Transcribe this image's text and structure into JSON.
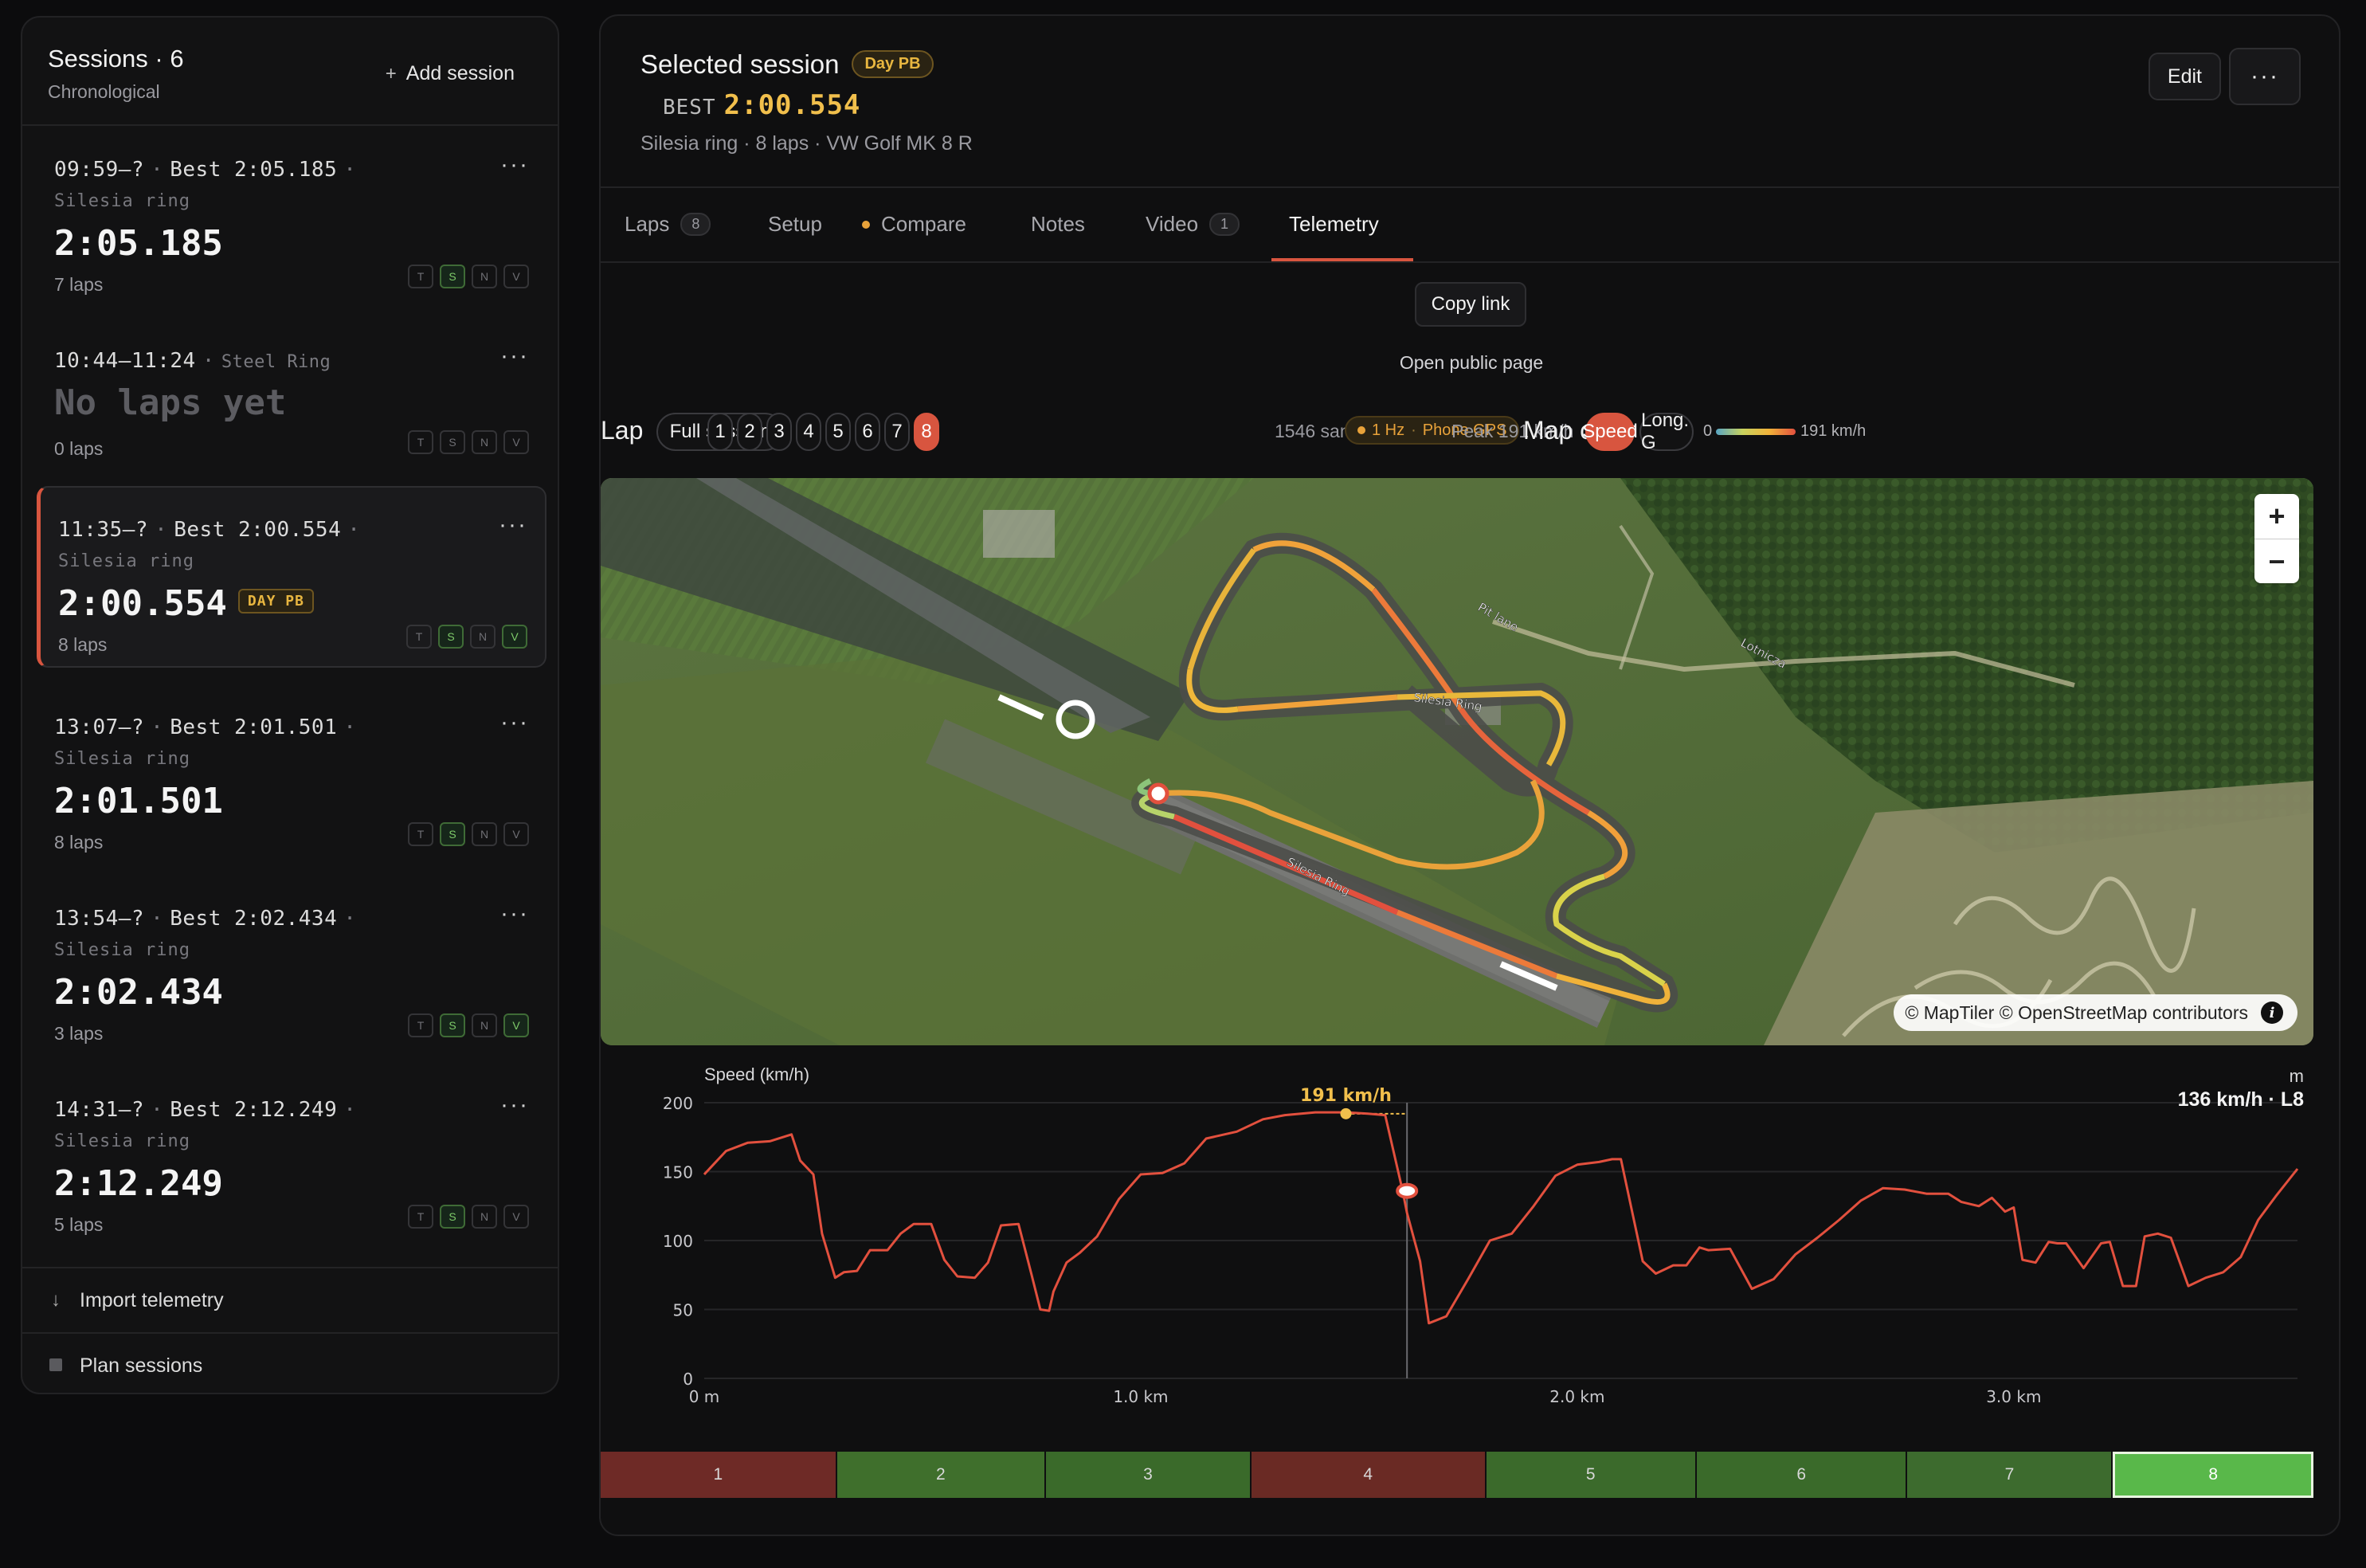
{
  "sidebar": {
    "title": "Sessions · 6",
    "subtitle": "Chronological",
    "add_label": "Add session",
    "sessions": [
      {
        "time_range": "09:59–?",
        "best_text": "Best 2:05.185",
        "track": "Silesia ring",
        "time": "2:05.185",
        "laps": "7 laps",
        "badge": "",
        "tags": [
          "T",
          "S",
          "N",
          "V"
        ],
        "tags_on": [
          false,
          true,
          false,
          false
        ],
        "active": false,
        "empty": false
      },
      {
        "time_range": "10:44–11:24",
        "best_text": "",
        "track": "Steel Ring",
        "time": "No laps yet",
        "laps": "0 laps",
        "badge": "",
        "tags": [
          "T",
          "S",
          "N",
          "V"
        ],
        "tags_on": [
          false,
          false,
          false,
          false
        ],
        "active": false,
        "empty": true
      },
      {
        "time_range": "11:35–?",
        "best_text": "Best 2:00.554",
        "track": "Silesia ring",
        "time": "2:00.554",
        "laps": "8 laps",
        "badge": "DAY PB",
        "tags": [
          "T",
          "S",
          "N",
          "V"
        ],
        "tags_on": [
          false,
          true,
          false,
          true
        ],
        "active": true,
        "empty": false
      },
      {
        "time_range": "13:07–?",
        "best_text": "Best 2:01.501",
        "track": "Silesia ring",
        "time": "2:01.501",
        "laps": "8 laps",
        "badge": "",
        "tags": [
          "T",
          "S",
          "N",
          "V"
        ],
        "tags_on": [
          false,
          true,
          false,
          false
        ],
        "active": false,
        "empty": false
      },
      {
        "time_range": "13:54–?",
        "best_text": "Best 2:02.434",
        "track": "Silesia ring",
        "time": "2:02.434",
        "laps": "3 laps",
        "badge": "",
        "tags": [
          "T",
          "S",
          "N",
          "V"
        ],
        "tags_on": [
          false,
          true,
          false,
          true
        ],
        "active": false,
        "empty": false
      },
      {
        "time_range": "14:31–?",
        "best_text": "Best 2:12.249",
        "track": "Silesia ring",
        "time": "2:12.249",
        "laps": "5 laps",
        "badge": "",
        "tags": [
          "T",
          "S",
          "N",
          "V"
        ],
        "tags_on": [
          false,
          true,
          false,
          false
        ],
        "active": false,
        "empty": false
      }
    ],
    "import_label": "Import telemetry",
    "plan_label": "Plan sessions"
  },
  "header": {
    "title": "Selected session",
    "badge": "Day PB",
    "best_label": "BEST",
    "best_time": "2:00.554",
    "meta": "Silesia ring · 8 laps · VW Golf MK 8 R",
    "edit_label": "Edit"
  },
  "tabs": [
    {
      "label": "Laps",
      "count": "8"
    },
    {
      "label": "Setup",
      "count": ""
    },
    {
      "label": "Compare",
      "count": ""
    },
    {
      "label": "Notes",
      "count": ""
    },
    {
      "label": "Video",
      "count": "1"
    },
    {
      "label": "Telemetry",
      "count": ""
    }
  ],
  "active_tab": "Telemetry",
  "telemetry": {
    "copy_link": "Copy link",
    "open_public": "Open public page",
    "lap_label": "Lap",
    "full_session": "Full session",
    "laps": [
      "1",
      "2",
      "3",
      "4",
      "5",
      "6",
      "7",
      "8"
    ],
    "selected_lap": "8",
    "samples": "1546 samples",
    "gps_rate": "1 Hz",
    "gps_source": "Phone GPS",
    "peak": "Peak 191 km/h",
    "map_color_label": "Map color",
    "color_modes": [
      "Speed",
      "Long. G"
    ],
    "selected_mode": "Speed",
    "scale_min": "0",
    "scale_max": "191 km/h"
  },
  "map": {
    "attribution": "© MapTiler © OpenStreetMap contributors",
    "labels": [
      "Silesia Ring",
      "Silesia Ring",
      "Pit lane",
      "Lotnicza"
    ]
  },
  "chart_data": {
    "type": "line",
    "title": "Speed (km/h)",
    "unit_label": "m",
    "readout": "136 km/h · L8",
    "peak_label": "191 km/h",
    "xlabel": "",
    "ylabel": "Speed (km/h)",
    "x_ticks": [
      "0 m",
      "1.0 km",
      "2.0 km",
      "3.0 km"
    ],
    "y_ticks": [
      0,
      50,
      100,
      150,
      200
    ],
    "xlim": [
      0,
      3.65
    ],
    "ylim": [
      0,
      200
    ],
    "grid": true,
    "peak_x_km": 1.47,
    "cursor_x_km": 1.61,
    "cursor_speed": 136,
    "x_km": [
      0,
      0.05,
      0.1,
      0.15,
      0.2,
      0.22,
      0.25,
      0.27,
      0.3,
      0.32,
      0.35,
      0.38,
      0.42,
      0.45,
      0.48,
      0.52,
      0.55,
      0.58,
      0.62,
      0.65,
      0.68,
      0.72,
      0.75,
      0.77,
      0.79,
      0.8,
      0.83,
      0.86,
      0.9,
      0.95,
      1.0,
      1.05,
      1.1,
      1.15,
      1.22,
      1.28,
      1.33,
      1.4,
      1.47,
      1.52,
      1.56,
      1.6,
      1.61,
      1.64,
      1.66,
      1.7,
      1.75,
      1.8,
      1.85,
      1.9,
      1.95,
      2.0,
      2.05,
      2.08,
      2.1,
      2.15,
      2.18,
      2.22,
      2.25,
      2.28,
      2.3,
      2.35,
      2.4,
      2.45,
      2.5,
      2.55,
      2.6,
      2.65,
      2.7,
      2.75,
      2.8,
      2.85,
      2.88,
      2.92,
      2.95,
      2.98,
      3.0,
      3.02,
      3.05,
      3.08,
      3.1,
      3.12,
      3.16,
      3.2,
      3.22,
      3.25,
      3.28,
      3.3,
      3.33,
      3.36,
      3.4,
      3.44,
      3.48,
      3.52,
      3.56,
      3.6,
      3.65
    ],
    "speed": [
      148,
      165,
      171,
      172,
      177,
      158,
      148,
      105,
      73,
      77,
      78,
      93,
      93,
      105,
      112,
      112,
      86,
      74,
      73,
      84,
      111,
      112,
      75,
      50,
      49,
      63,
      84,
      91,
      103,
      130,
      148,
      149,
      156,
      174,
      179,
      188,
      191,
      193,
      193,
      192,
      191,
      136,
      120,
      85,
      40,
      45,
      72,
      100,
      105,
      125,
      147,
      155,
      157,
      159,
      159,
      85,
      76,
      82,
      82,
      95,
      93,
      94,
      65,
      72,
      90,
      102,
      115,
      129,
      138,
      137,
      134,
      134,
      128,
      125,
      131,
      121,
      124,
      86,
      84,
      99,
      98,
      98,
      80,
      98,
      99,
      67,
      67,
      103,
      105,
      102,
      67,
      73,
      77,
      88,
      115,
      132,
      152
    ]
  },
  "lap_strip": {
    "laps": [
      "1",
      "2",
      "3",
      "4",
      "5",
      "6",
      "7",
      "8"
    ],
    "colors": [
      "#6e2a26",
      "#3f6f2c",
      "#3a6a2a",
      "#6a2a24",
      "#3b6a2b",
      "#3a6a2a",
      "#3d6b2e",
      "#59b84a"
    ],
    "widths": [
      0.138,
      0.122,
      0.12,
      0.137,
      0.123,
      0.123,
      0.12,
      0.117
    ]
  }
}
